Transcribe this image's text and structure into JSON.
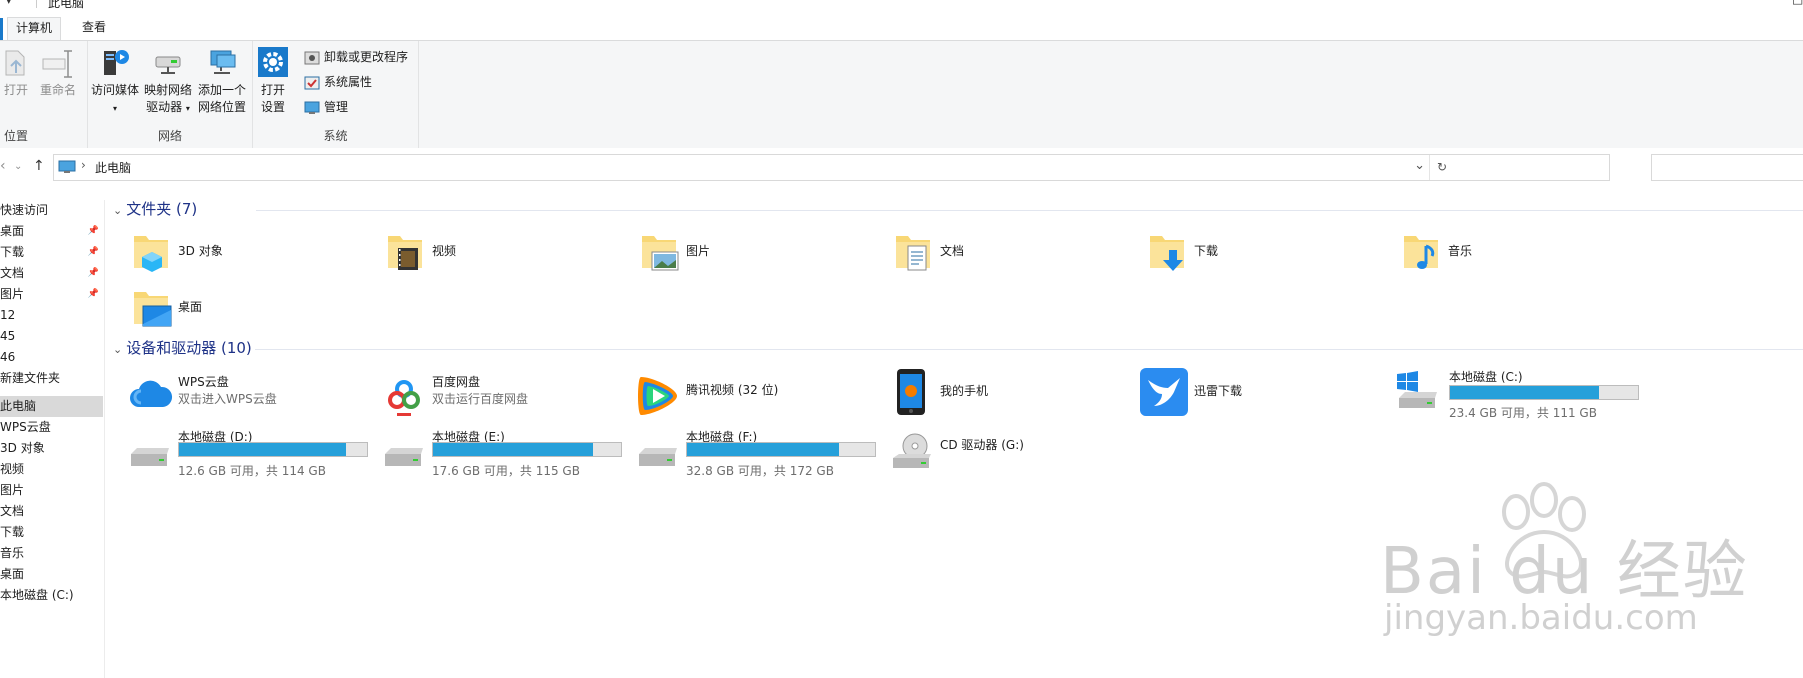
{
  "window": {
    "title": "此电脑"
  },
  "ribbon": {
    "tabs": [
      {
        "label": "计算机",
        "active": true
      },
      {
        "label": "查看",
        "active": false
      }
    ],
    "location": {
      "label": "位置",
      "open": "打开",
      "rename": "重命名"
    },
    "network": {
      "label": "网络",
      "media_line1": "访问媒体",
      "map_line1": "映射网络",
      "map_line2": "驱动器",
      "add_line1": "添加一个",
      "add_line2": "网络位置"
    },
    "system": {
      "label": "系统",
      "open_settings_line1": "打开",
      "open_settings_line2": "设置",
      "uninstall": "卸载或更改程序",
      "properties": "系统属性",
      "manage": "管理"
    }
  },
  "address": {
    "path": "此电脑"
  },
  "nav": {
    "items": [
      {
        "label": "快速访问",
        "pinned": false
      },
      {
        "label": "桌面",
        "pinned": true
      },
      {
        "label": "下载",
        "pinned": true
      },
      {
        "label": "文档",
        "pinned": true
      },
      {
        "label": "图片",
        "pinned": true
      },
      {
        "label": "12",
        "pinned": false
      },
      {
        "label": "45",
        "pinned": false
      },
      {
        "label": "46",
        "pinned": false
      },
      {
        "label": "新建文件夹",
        "pinned": false
      },
      {
        "label": "此电脑",
        "pinned": false,
        "selected": true
      },
      {
        "label": "WPS云盘",
        "pinned": false
      },
      {
        "label": "3D 对象",
        "pinned": false
      },
      {
        "label": "视频",
        "pinned": false
      },
      {
        "label": "图片",
        "pinned": false
      },
      {
        "label": "文档",
        "pinned": false
      },
      {
        "label": "下载",
        "pinned": false
      },
      {
        "label": "音乐",
        "pinned": false
      },
      {
        "label": "桌面",
        "pinned": false
      },
      {
        "label": "本地磁盘 (C:)",
        "pinned": false
      }
    ]
  },
  "folders": {
    "header": "文件夹 (7)",
    "items": [
      {
        "label": "3D 对象",
        "icon": "folder-3d-icon"
      },
      {
        "label": "视频",
        "icon": "folder-video-icon"
      },
      {
        "label": "图片",
        "icon": "folder-pictures-icon"
      },
      {
        "label": "文档",
        "icon": "folder-documents-icon"
      },
      {
        "label": "下载",
        "icon": "folder-downloads-icon"
      },
      {
        "label": "音乐",
        "icon": "folder-music-icon"
      },
      {
        "label": "桌面",
        "icon": "folder-desktop-icon"
      }
    ]
  },
  "devices": {
    "header": "设备和驱动器 (10)",
    "items": [
      {
        "label": "WPS云盘",
        "sub": "双击进入WPS云盘",
        "icon": "wps-cloud-icon"
      },
      {
        "label": "百度网盘",
        "sub": "双击运行百度网盘",
        "icon": "baidu-netdisk-icon"
      },
      {
        "label": "腾讯视频 (32 位)",
        "sub": "",
        "icon": "tencent-video-icon"
      },
      {
        "label": "我的手机",
        "sub": "",
        "icon": "phone-icon"
      },
      {
        "label": "迅雷下载",
        "sub": "",
        "icon": "xunlei-icon"
      },
      {
        "label": "本地磁盘 (C:)",
        "cap": "23.4 GB 可用，共 111 GB",
        "used": 0.79,
        "icon": "windows-drive-icon"
      },
      {
        "label": "本地磁盘 (D:)",
        "cap": "12.6 GB 可用，共 114 GB",
        "used": 0.89,
        "icon": "drive-icon"
      },
      {
        "label": "本地磁盘 (E:)",
        "cap": "17.6 GB 可用，共 115 GB",
        "used": 0.85,
        "icon": "drive-icon"
      },
      {
        "label": "本地磁盘 (F:)",
        "cap": "32.8 GB 可用，共 172 GB",
        "used": 0.81,
        "icon": "drive-icon"
      },
      {
        "label": "CD 驱动器 (G:)",
        "sub": "",
        "icon": "cd-drive-icon"
      }
    ]
  },
  "watermark": {
    "line1": "Bai du 经验",
    "line2": "jingyan.baidu.com"
  },
  "colors": {
    "accent": "#1979ca",
    "bar": "#26a0da",
    "folder": "#f8d775",
    "header": "#1e3287"
  }
}
